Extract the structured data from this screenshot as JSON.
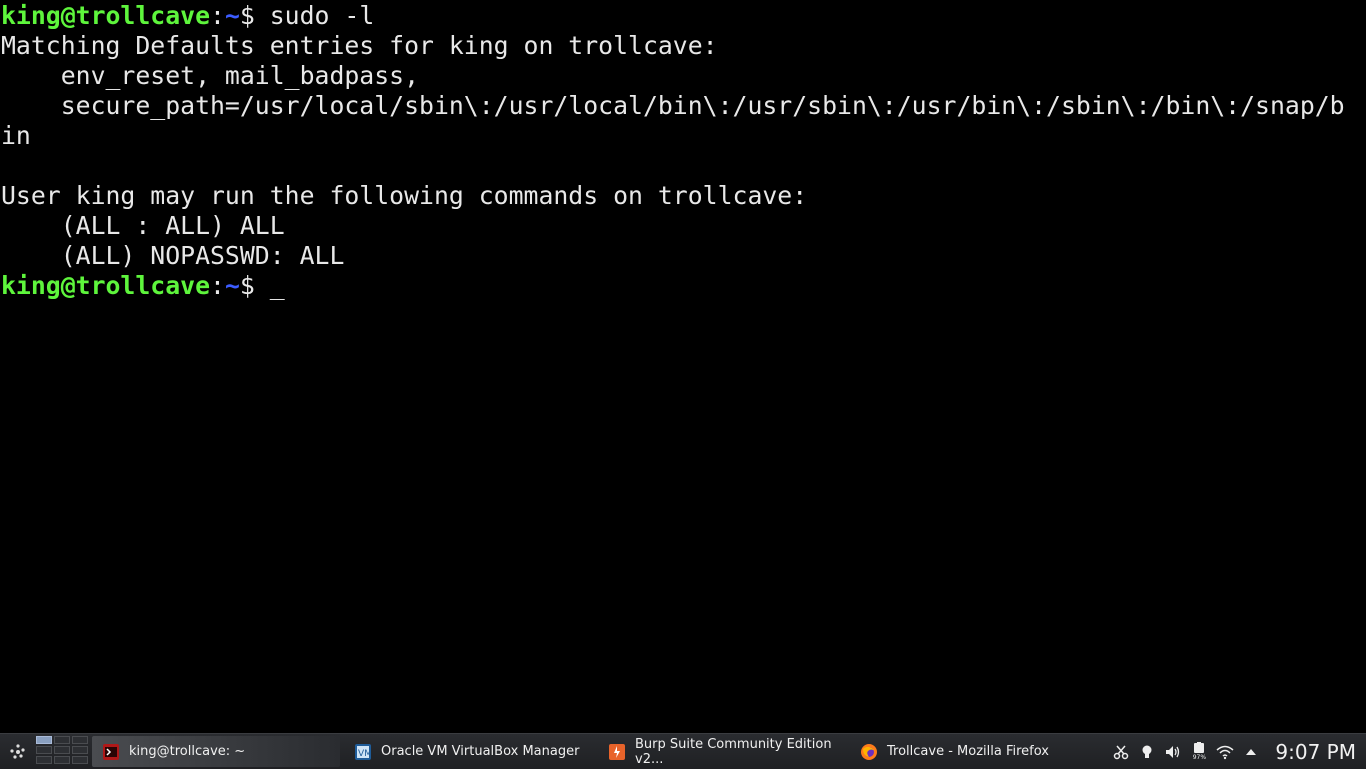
{
  "terminal": {
    "line1": {
      "user": "king@trollcave",
      "colon": ":",
      "path": "~",
      "cmd": "$ sudo -l"
    },
    "line2": "Matching Defaults entries for king on trollcave:",
    "line3": "    env_reset, mail_badpass,",
    "line4": "    secure_path=/usr/local/sbin\\:/usr/local/bin\\:/usr/sbin\\:/usr/bin\\:/sbin\\:/bin\\:/snap/b",
    "line5": "in",
    "line6": "",
    "line7": "User king may run the following commands on trollcave:",
    "line8": "    (ALL : ALL) ALL",
    "line9": "    (ALL) NOPASSWD: ALL",
    "line10": {
      "user": "king@trollcave",
      "colon": ":",
      "path": "~",
      "cmd": "$ ",
      "cursor": "_"
    }
  },
  "taskbar": {
    "tasks": [
      {
        "label": "king@trollcave: ~",
        "icon": "terminal-icon"
      },
      {
        "label": "Oracle VM VirtualBox Manager",
        "icon": "virtualbox-icon"
      },
      {
        "label": "Burp Suite Community Edition v2...",
        "icon": "burp-icon"
      },
      {
        "label": "Trollcave - Mozilla Firefox",
        "icon": "firefox-icon"
      }
    ],
    "battery_level": "97%",
    "clock": "9:07 PM"
  },
  "colors": {
    "prompt_user": "#5ef53c",
    "prompt_path": "#3c5cff",
    "text": "#e8e8e8"
  }
}
